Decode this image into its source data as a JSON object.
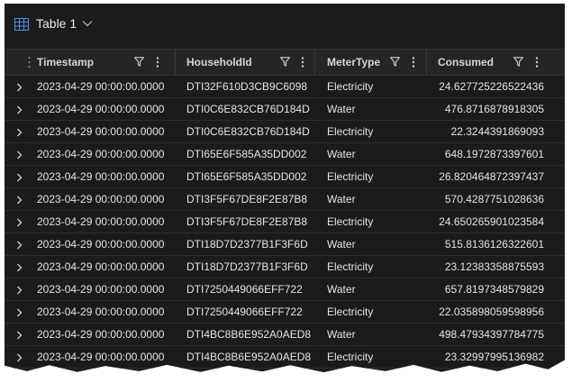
{
  "title": "Table 1",
  "columns": [
    {
      "key": "timestamp",
      "label": "Timestamp"
    },
    {
      "key": "householdId",
      "label": "HouseholdId"
    },
    {
      "key": "meterType",
      "label": "MeterType"
    },
    {
      "key": "consumed",
      "label": "Consumed"
    }
  ],
  "rows": [
    {
      "timestamp": "2023-04-29 00:00:00.0000",
      "householdId": "DTI32F610D3CB9C6098",
      "meterType": "Electricity",
      "consumed": "24.627725226522436"
    },
    {
      "timestamp": "2023-04-29 00:00:00.0000",
      "householdId": "DTI0C6E832CB76D184D",
      "meterType": "Water",
      "consumed": "476.8716878918305"
    },
    {
      "timestamp": "2023-04-29 00:00:00.0000",
      "householdId": "DTI0C6E832CB76D184D",
      "meterType": "Electricity",
      "consumed": "22.3244391869093"
    },
    {
      "timestamp": "2023-04-29 00:00:00.0000",
      "householdId": "DTI65E6F585A35DD002",
      "meterType": "Water",
      "consumed": "648.1972873397601"
    },
    {
      "timestamp": "2023-04-29 00:00:00.0000",
      "householdId": "DTI65E6F585A35DD002",
      "meterType": "Electricity",
      "consumed": "26.820464872397437"
    },
    {
      "timestamp": "2023-04-29 00:00:00.0000",
      "householdId": "DTI3F5F67DE8F2E87B8",
      "meterType": "Water",
      "consumed": "570.4287751028636"
    },
    {
      "timestamp": "2023-04-29 00:00:00.0000",
      "householdId": "DTI3F5F67DE8F2E87B8",
      "meterType": "Electricity",
      "consumed": "24.650265901023584"
    },
    {
      "timestamp": "2023-04-29 00:00:00.0000",
      "householdId": "DTI18D7D2377B1F3F6D",
      "meterType": "Water",
      "consumed": "515.8136126322601"
    },
    {
      "timestamp": "2023-04-29 00:00:00.0000",
      "householdId": "DTI18D7D2377B1F3F6D",
      "meterType": "Electricity",
      "consumed": "23.12383358875593"
    },
    {
      "timestamp": "2023-04-29 00:00:00.0000",
      "householdId": "DTI7250449066EFF722",
      "meterType": "Water",
      "consumed": "657.8197348579829"
    },
    {
      "timestamp": "2023-04-29 00:00:00.0000",
      "householdId": "DTI7250449066EFF722",
      "meterType": "Electricity",
      "consumed": "22.035898059598956"
    },
    {
      "timestamp": "2023-04-29 00:00:00.0000",
      "householdId": "DTI4BC8B6E952A0AED8",
      "meterType": "Water",
      "consumed": "498.47934397784775"
    },
    {
      "timestamp": "2023-04-29 00:00:00.0000",
      "householdId": "DTI4BC8B6E952A0AED8",
      "meterType": "Electricity",
      "consumed": "23.32997995136982"
    }
  ],
  "colors": {
    "background": "#1b1b1b",
    "header": "#252525",
    "text": "#e4e4e4",
    "accent": "#4f8fe8"
  },
  "icons": {
    "table": "table-icon",
    "dropdown": "chevron-down-icon",
    "filter": "filter-icon",
    "more": "more-vertical-icon",
    "expand": "chevron-right-icon"
  }
}
